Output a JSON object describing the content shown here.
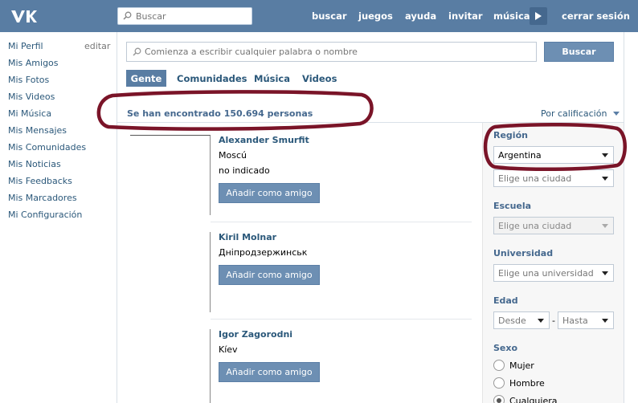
{
  "header": {
    "search_placeholder": "Buscar",
    "nav": [
      "buscar",
      "juegos",
      "ayuda",
      "invitar",
      "música",
      "cerrar sesión"
    ]
  },
  "sidebar": {
    "items": [
      "Mi Perfil",
      "Mis Amigos",
      "Mis Fotos",
      "Mis Videos",
      "Mi Música",
      "Mis Mensajes",
      "Mis Comunidades",
      "Mis Noticias",
      "Mis Feedbacks",
      "Mis Marcadores",
      "Mi Configuración"
    ],
    "edit_label": "editar"
  },
  "search": {
    "placeholder": "Comienza a escribir cualquier palabra o nombre",
    "button_label": "Buscar"
  },
  "tabs": [
    {
      "label": "Gente",
      "active": true
    },
    {
      "label": "Comunidades",
      "active": false
    },
    {
      "label": "Música",
      "active": false
    },
    {
      "label": "Videos",
      "active": false
    }
  ],
  "results": {
    "count_text": "Se han encontrado 150.694 personas",
    "sort_label": "Por calificación"
  },
  "people": [
    {
      "name": "Alexander Smurfit",
      "city": "Moscú",
      "extra": "no indicado",
      "button": "Añadir como amigo"
    },
    {
      "name": "Kiril Molnar",
      "city": "Дніпродзержинськ",
      "extra": "",
      "button": "Añadir como amigo"
    },
    {
      "name": "Igor Zagorodni",
      "city": "Kíev",
      "extra": "",
      "button": "Añadir como amigo"
    }
  ],
  "filters": {
    "region_label": "Región",
    "region_value": "Argentina",
    "city_placeholder": "Elige una ciudad",
    "school_label": "Escuela",
    "school_placeholder": "Elige una ciudad",
    "university_label": "Universidad",
    "university_placeholder": "Elige una universidad",
    "age_label": "Edad",
    "age_from": "Desde",
    "age_dash": "-",
    "age_to": "Hasta",
    "sex_label": "Sexo",
    "sex_options": [
      {
        "label": "Mujer",
        "checked": false
      },
      {
        "label": "Hombre",
        "checked": false
      },
      {
        "label": "Cualquiera",
        "checked": true
      }
    ]
  },
  "colors": {
    "header": "#597da3",
    "link": "#2b587a",
    "button": "#6d8fb3",
    "annotation": "#7a1428"
  }
}
